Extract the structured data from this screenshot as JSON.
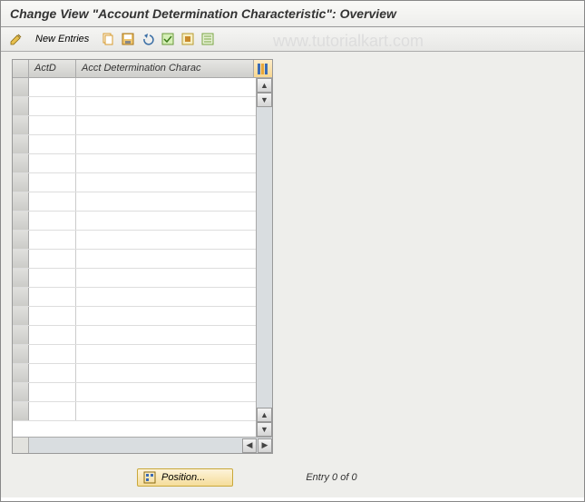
{
  "title": "Change View \"Account Determination Characteristic\": Overview",
  "toolbar": {
    "new_entries_label": "New Entries"
  },
  "columns": {
    "actd": "ActD",
    "desc": "Acct Determination Charac"
  },
  "footer": {
    "position_label": "Position...",
    "entry_status": "Entry 0 of 0"
  },
  "watermark": "www.tutorialkart.com"
}
